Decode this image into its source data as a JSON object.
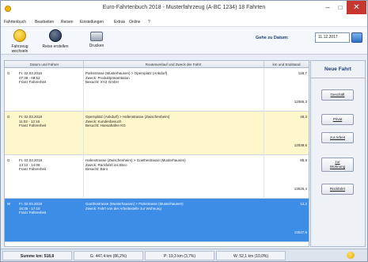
{
  "window": {
    "title": "Euro-Fahrtenbuch 2018 - Musterfahrzeug (A-BC 1234) 18 Fahrten",
    "minimize_glyph": "–",
    "maximize_glyph": "□",
    "close_glyph": "✕"
  },
  "menu": [
    "Fahrtenbuch",
    "Bearbeiten",
    "Reisen",
    "Einstellungen",
    "Extras",
    "Online",
    "?"
  ],
  "toolbar": {
    "change_vehicle": "Fahrzeug wechseln",
    "create_trip": "Reise erstellen",
    "print": "Drucken",
    "goto_date_label": "Gehe zu Datum:",
    "goto_date_value": "11.12.2017"
  },
  "table": {
    "headers": [
      "Datum und Fahrer",
      "Routenverlauf und Zweck der Fahrt",
      "km und Endstand"
    ],
    "rows": [
      {
        "mark": "G",
        "date": "Fr. 02.03.2018",
        "time": "07:38 - 09:52",
        "driver": "Franz Fahrenheit",
        "route": "Parkstrasse (Musterhausen) > Opernplatz (Ankdurf)",
        "purpose": "Zweck: Produktpräsentation",
        "visit": "Besucht: XYZ GmbH",
        "km": "128,7",
        "end": "12085,3",
        "selected": false,
        "highlight": false
      },
      {
        "mark": "G",
        "date": "Fr. 02.03.2018",
        "time": "11:02 - 12:16",
        "driver": "Franz Fahrenheit",
        "route": "Opernplatz (Ankdurf) > Hafenstrasse (Zwischenheim)",
        "purpose": "Zweck: Kundenbesuch",
        "visit": "Besucht: Hansahafen KG",
        "km": "48,3",
        "end": "12039,6",
        "selected": false,
        "highlight": true
      },
      {
        "mark": "G",
        "date": "Fr. 02.03.2018",
        "time": "13:12 - 14:08",
        "driver": "Franz Fahrenheit",
        "route": "Hafenstrasse (Zwischenheim) > Goethestrasse (Musterhausen)",
        "purpose": "Zweck: Rückfahrt ins Büro",
        "visit": "Besucht: Büro",
        "km": "85,8",
        "end": "13025,4",
        "selected": false,
        "highlight": false
      },
      {
        "mark": "W",
        "date": "Fr. 02.03.2018",
        "time": "16:35 - 17:10",
        "driver": "Franz Fahrenheit",
        "route": "Goethestrasse (Musterhausen) > Parkstrasse (Musterhausen)",
        "purpose": "Zweck: Fahrt von der Arbeitsstelle zur Wohnung",
        "visit": "",
        "km": "12,2",
        "end": "13037,6",
        "selected": true,
        "highlight": false
      }
    ]
  },
  "side": {
    "title": "Neue Fahrt",
    "btn_business": "Geschäft",
    "btn_private": "Privat",
    "btn_work": "zur Arbeit",
    "btn_home_1": "zur",
    "btn_home_2": "Wohnung",
    "btn_return": "Rückfahrt"
  },
  "status": {
    "sum": "Summe km: 518,8",
    "business": "G: 447,4 km (86,2%)",
    "private": "P: 19,3 km (3,7%)",
    "work": "W: 52,1 km (10,0%)"
  },
  "colors": {
    "selected_row": "#3d8de6",
    "highlight_row": "#fff7cc",
    "close_button": "#c7372f"
  },
  "icons": [
    "app-icon",
    "change-vehicle-icon",
    "create-trip-icon",
    "print-icon",
    "calendar-icon",
    "status-grip-icon"
  ]
}
